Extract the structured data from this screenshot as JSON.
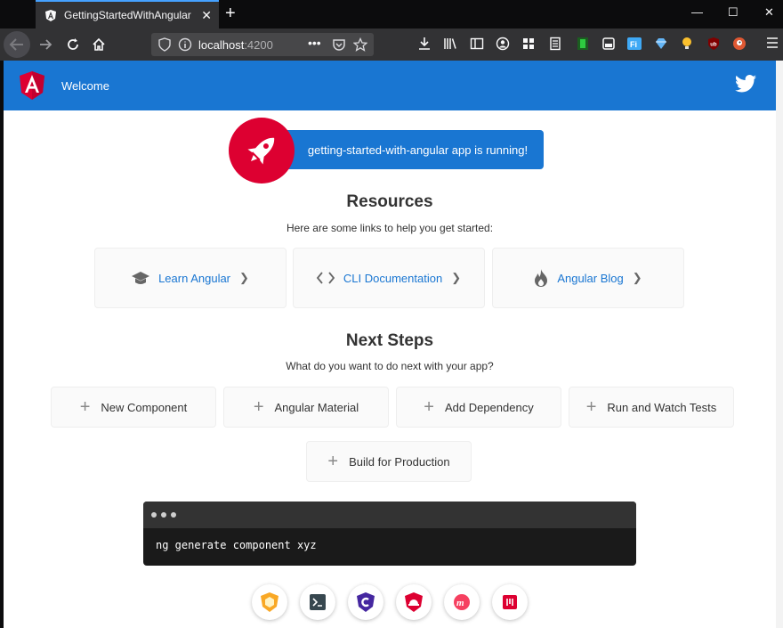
{
  "browser": {
    "tab_title": "GettingStartedWithAngular",
    "url_host": "localhost",
    "url_port": ":4200",
    "accent": "#45a1ff"
  },
  "app": {
    "toolbar": {
      "title": "Welcome",
      "color": "#1976d2"
    },
    "banner": {
      "text": "getting-started-with-angular app is running!"
    },
    "resources": {
      "heading": "Resources",
      "subheading": "Here are some links to help you get started:",
      "links": [
        {
          "label": "Learn Angular",
          "icon": "graduation-cap-icon"
        },
        {
          "label": "CLI Documentation",
          "icon": "code-icon"
        },
        {
          "label": "Angular Blog",
          "icon": "flame-icon"
        }
      ]
    },
    "next_steps": {
      "heading": "Next Steps",
      "subheading": "What do you want to do next with your app?",
      "buttons": [
        {
          "label": "New Component"
        },
        {
          "label": "Angular Material"
        },
        {
          "label": "Add Dependency"
        },
        {
          "label": "Run and Watch Tests"
        },
        {
          "label": "Build for Production"
        }
      ]
    },
    "terminal": {
      "command": "ng generate component xyz"
    },
    "bottom_icons": [
      "animations-icon",
      "cli-icon",
      "protractor-icon",
      "augury-icon",
      "meetup-icon",
      "discord-icon"
    ]
  }
}
